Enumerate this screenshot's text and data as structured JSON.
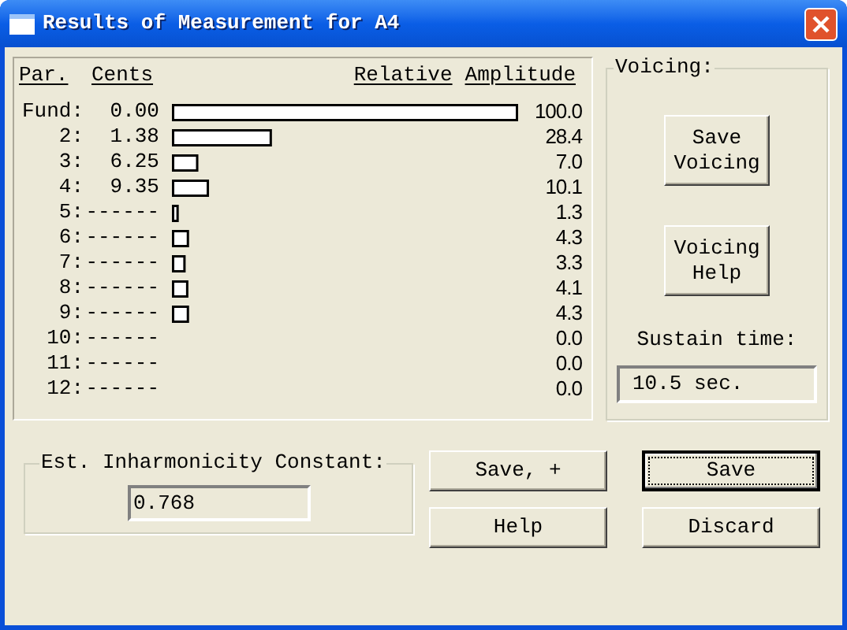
{
  "window": {
    "title": "Results of Measurement for A4"
  },
  "table": {
    "columns": [
      "Par.",
      "Cents",
      "Relative",
      "Amplitude"
    ],
    "label_separator": ":",
    "cents": [
      "0.00",
      "1.38",
      "6.25",
      "9.35",
      "------",
      "------",
      "------",
      "------",
      "------",
      "------",
      "------",
      "------"
    ],
    "chart_data": {
      "type": "bar",
      "orientation": "horizontal",
      "xlim": [
        0,
        100
      ],
      "categories": [
        "Fund",
        "2",
        "3",
        "4",
        "5",
        "6",
        "7",
        "8",
        "9",
        "10",
        "11",
        "12"
      ],
      "value_labels": [
        "100.0",
        "28.4",
        "7.0",
        "10.1",
        "1.3",
        "4.3",
        "3.3",
        "4.1",
        "4.3",
        "0.0",
        "0.0",
        "0.0"
      ],
      "values": [
        100.0,
        28.4,
        7.0,
        10.1,
        1.3,
        4.3,
        3.3,
        4.1,
        4.3,
        0.0,
        0.0,
        0.0
      ]
    }
  },
  "voicing": {
    "label": "Voicing:",
    "buttons": [
      "Save Voicing",
      "Voicing Help"
    ],
    "sustain_label": "Sustain time:",
    "sustain_value": "10.5 sec."
  },
  "inharmonicity": {
    "label": "Est. Inharmonicity Constant:",
    "value": "0.768"
  },
  "buttons": [
    {
      "label": "Save, +",
      "default": false
    },
    {
      "label": "Save",
      "default": true
    },
    {
      "label": "Help",
      "default": false
    },
    {
      "label": "Discard",
      "default": false
    }
  ]
}
